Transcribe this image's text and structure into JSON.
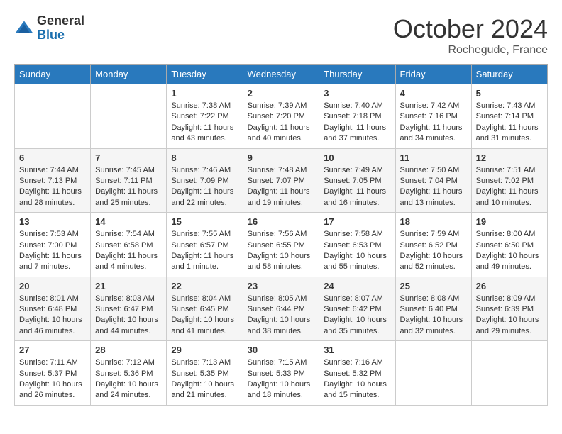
{
  "header": {
    "logo": {
      "general": "General",
      "blue": "Blue"
    },
    "title": "October 2024",
    "location": "Rochegude, France"
  },
  "calendar": {
    "days_of_week": [
      "Sunday",
      "Monday",
      "Tuesday",
      "Wednesday",
      "Thursday",
      "Friday",
      "Saturday"
    ],
    "weeks": [
      [
        {
          "day": "",
          "sunrise": "",
          "sunset": "",
          "daylight": ""
        },
        {
          "day": "",
          "sunrise": "",
          "sunset": "",
          "daylight": ""
        },
        {
          "day": "1",
          "sunrise": "Sunrise: 7:38 AM",
          "sunset": "Sunset: 7:22 PM",
          "daylight": "Daylight: 11 hours and 43 minutes."
        },
        {
          "day": "2",
          "sunrise": "Sunrise: 7:39 AM",
          "sunset": "Sunset: 7:20 PM",
          "daylight": "Daylight: 11 hours and 40 minutes."
        },
        {
          "day": "3",
          "sunrise": "Sunrise: 7:40 AM",
          "sunset": "Sunset: 7:18 PM",
          "daylight": "Daylight: 11 hours and 37 minutes."
        },
        {
          "day": "4",
          "sunrise": "Sunrise: 7:42 AM",
          "sunset": "Sunset: 7:16 PM",
          "daylight": "Daylight: 11 hours and 34 minutes."
        },
        {
          "day": "5",
          "sunrise": "Sunrise: 7:43 AM",
          "sunset": "Sunset: 7:14 PM",
          "daylight": "Daylight: 11 hours and 31 minutes."
        }
      ],
      [
        {
          "day": "6",
          "sunrise": "Sunrise: 7:44 AM",
          "sunset": "Sunset: 7:13 PM",
          "daylight": "Daylight: 11 hours and 28 minutes."
        },
        {
          "day": "7",
          "sunrise": "Sunrise: 7:45 AM",
          "sunset": "Sunset: 7:11 PM",
          "daylight": "Daylight: 11 hours and 25 minutes."
        },
        {
          "day": "8",
          "sunrise": "Sunrise: 7:46 AM",
          "sunset": "Sunset: 7:09 PM",
          "daylight": "Daylight: 11 hours and 22 minutes."
        },
        {
          "day": "9",
          "sunrise": "Sunrise: 7:48 AM",
          "sunset": "Sunset: 7:07 PM",
          "daylight": "Daylight: 11 hours and 19 minutes."
        },
        {
          "day": "10",
          "sunrise": "Sunrise: 7:49 AM",
          "sunset": "Sunset: 7:05 PM",
          "daylight": "Daylight: 11 hours and 16 minutes."
        },
        {
          "day": "11",
          "sunrise": "Sunrise: 7:50 AM",
          "sunset": "Sunset: 7:04 PM",
          "daylight": "Daylight: 11 hours and 13 minutes."
        },
        {
          "day": "12",
          "sunrise": "Sunrise: 7:51 AM",
          "sunset": "Sunset: 7:02 PM",
          "daylight": "Daylight: 11 hours and 10 minutes."
        }
      ],
      [
        {
          "day": "13",
          "sunrise": "Sunrise: 7:53 AM",
          "sunset": "Sunset: 7:00 PM",
          "daylight": "Daylight: 11 hours and 7 minutes."
        },
        {
          "day": "14",
          "sunrise": "Sunrise: 7:54 AM",
          "sunset": "Sunset: 6:58 PM",
          "daylight": "Daylight: 11 hours and 4 minutes."
        },
        {
          "day": "15",
          "sunrise": "Sunrise: 7:55 AM",
          "sunset": "Sunset: 6:57 PM",
          "daylight": "Daylight: 11 hours and 1 minute."
        },
        {
          "day": "16",
          "sunrise": "Sunrise: 7:56 AM",
          "sunset": "Sunset: 6:55 PM",
          "daylight": "Daylight: 10 hours and 58 minutes."
        },
        {
          "day": "17",
          "sunrise": "Sunrise: 7:58 AM",
          "sunset": "Sunset: 6:53 PM",
          "daylight": "Daylight: 10 hours and 55 minutes."
        },
        {
          "day": "18",
          "sunrise": "Sunrise: 7:59 AM",
          "sunset": "Sunset: 6:52 PM",
          "daylight": "Daylight: 10 hours and 52 minutes."
        },
        {
          "day": "19",
          "sunrise": "Sunrise: 8:00 AM",
          "sunset": "Sunset: 6:50 PM",
          "daylight": "Daylight: 10 hours and 49 minutes."
        }
      ],
      [
        {
          "day": "20",
          "sunrise": "Sunrise: 8:01 AM",
          "sunset": "Sunset: 6:48 PM",
          "daylight": "Daylight: 10 hours and 46 minutes."
        },
        {
          "day": "21",
          "sunrise": "Sunrise: 8:03 AM",
          "sunset": "Sunset: 6:47 PM",
          "daylight": "Daylight: 10 hours and 44 minutes."
        },
        {
          "day": "22",
          "sunrise": "Sunrise: 8:04 AM",
          "sunset": "Sunset: 6:45 PM",
          "daylight": "Daylight: 10 hours and 41 minutes."
        },
        {
          "day": "23",
          "sunrise": "Sunrise: 8:05 AM",
          "sunset": "Sunset: 6:44 PM",
          "daylight": "Daylight: 10 hours and 38 minutes."
        },
        {
          "day": "24",
          "sunrise": "Sunrise: 8:07 AM",
          "sunset": "Sunset: 6:42 PM",
          "daylight": "Daylight: 10 hours and 35 minutes."
        },
        {
          "day": "25",
          "sunrise": "Sunrise: 8:08 AM",
          "sunset": "Sunset: 6:40 PM",
          "daylight": "Daylight: 10 hours and 32 minutes."
        },
        {
          "day": "26",
          "sunrise": "Sunrise: 8:09 AM",
          "sunset": "Sunset: 6:39 PM",
          "daylight": "Daylight: 10 hours and 29 minutes."
        }
      ],
      [
        {
          "day": "27",
          "sunrise": "Sunrise: 7:11 AM",
          "sunset": "Sunset: 5:37 PM",
          "daylight": "Daylight: 10 hours and 26 minutes."
        },
        {
          "day": "28",
          "sunrise": "Sunrise: 7:12 AM",
          "sunset": "Sunset: 5:36 PM",
          "daylight": "Daylight: 10 hours and 24 minutes."
        },
        {
          "day": "29",
          "sunrise": "Sunrise: 7:13 AM",
          "sunset": "Sunset: 5:35 PM",
          "daylight": "Daylight: 10 hours and 21 minutes."
        },
        {
          "day": "30",
          "sunrise": "Sunrise: 7:15 AM",
          "sunset": "Sunset: 5:33 PM",
          "daylight": "Daylight: 10 hours and 18 minutes."
        },
        {
          "day": "31",
          "sunrise": "Sunrise: 7:16 AM",
          "sunset": "Sunset: 5:32 PM",
          "daylight": "Daylight: 10 hours and 15 minutes."
        },
        {
          "day": "",
          "sunrise": "",
          "sunset": "",
          "daylight": ""
        },
        {
          "day": "",
          "sunrise": "",
          "sunset": "",
          "daylight": ""
        }
      ]
    ]
  }
}
